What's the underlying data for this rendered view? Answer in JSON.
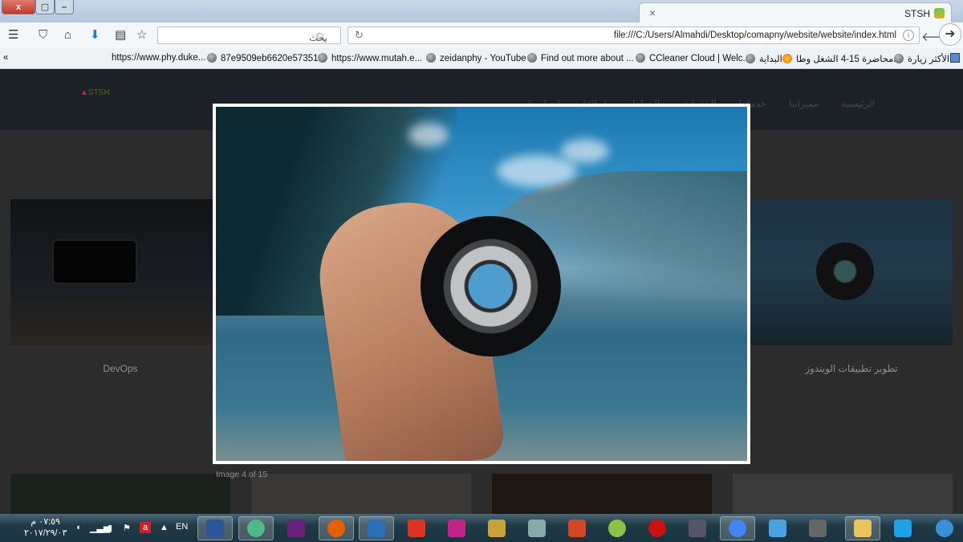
{
  "window": {
    "close": "x",
    "tab_title": "STSH",
    "new_tab": "+",
    "tab_close": "×"
  },
  "toolbar": {
    "search_placeholder": "بحث",
    "url": "file:///C:/Users/Almahdi/Desktop/comapny/website/website/index.html"
  },
  "bookmarks": [
    "https://www.phy.duke...",
    "87e9509eb6620e57351...",
    "https://www.mutah.e...",
    "zeidanphy - YouTube",
    "Find out more about ...",
    "CCleaner Cloud | Welc...",
    "البداية",
    "محاضرة 15-4 الشغل وطا...",
    "الأكثر زيارة"
  ],
  "bookmarks_overflow": "«",
  "site": {
    "logo": "STSH",
    "nav": [
      "الرئيسية",
      "مميزاتنا",
      "خدماتنا",
      "الخدمات",
      "الخطط",
      "عملائنا",
      "اتصل بنا"
    ],
    "cards": [
      {
        "label": "DevOps"
      },
      {
        "label": "تطوير تطبيقات الويندوز"
      }
    ]
  },
  "lightbox": {
    "caption": "Image 4 of 15"
  },
  "taskbar": {
    "time": "٠٧:٥٩ م",
    "date": "٢٠١٧/٢٩/٠٣",
    "lang": "EN",
    "apps": [
      {
        "name": "word",
        "color": "#2b579a"
      },
      {
        "name": "atom",
        "color": "#4dba87"
      },
      {
        "name": "visual-studio",
        "color": "#68217a"
      },
      {
        "name": "firefox",
        "color": "#e66000"
      },
      {
        "name": "app-hexagon",
        "color": "#2a6fb8"
      },
      {
        "name": "zotero",
        "color": "#d32"
      },
      {
        "name": "app-shield",
        "color": "#c2258a"
      },
      {
        "name": "tools",
        "color": "#c9a23a"
      },
      {
        "name": "paint",
        "color": "#8aa"
      },
      {
        "name": "powerpoint",
        "color": "#d24726"
      },
      {
        "name": "android-studio",
        "color": "#8bc34a"
      },
      {
        "name": "driver-booster",
        "color": "#c11"
      },
      {
        "name": "camera-tool",
        "color": "#556"
      },
      {
        "name": "chrome",
        "color": "#4285f4"
      },
      {
        "name": "media-player",
        "color": "#4aa3df"
      },
      {
        "name": "sublime-text",
        "color": "#666"
      },
      {
        "name": "file-explorer",
        "color": "#e8c45a"
      },
      {
        "name": "internet-explorer",
        "color": "#1ea1e6"
      },
      {
        "name": "start",
        "color": "#3a8fd6"
      }
    ]
  }
}
